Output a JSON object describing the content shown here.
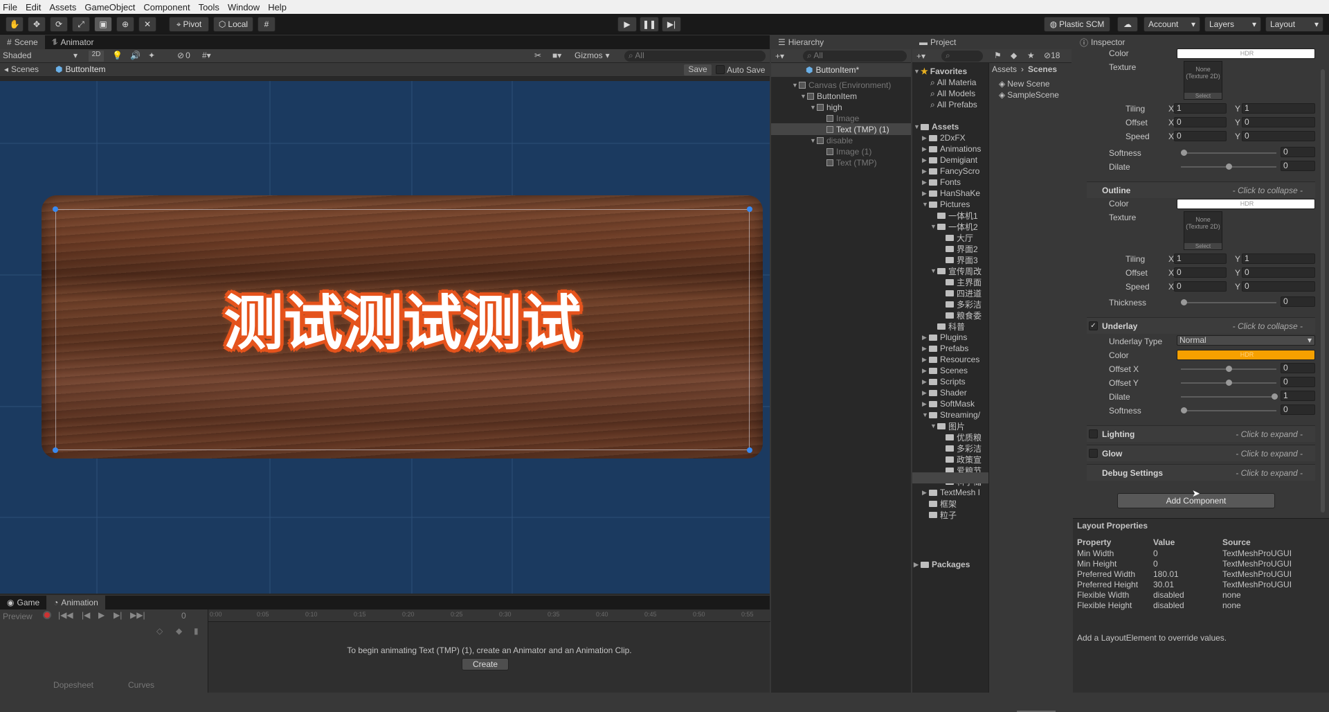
{
  "menu": [
    "File",
    "Edit",
    "Assets",
    "GameObject",
    "Component",
    "Tools",
    "Window",
    "Help"
  ],
  "toolbar": {
    "pivot": "Pivot",
    "local": "Local",
    "plastic": "Plastic SCM",
    "account": "Account",
    "layers": "Layers",
    "layout": "Layout"
  },
  "scene": {
    "tabs": [
      "Scene",
      "Animator"
    ],
    "shading": "Shaded",
    "mode2d": "2D",
    "gizmos": "Gizmos",
    "search_placeholder": "All",
    "count": "0",
    "bc_root": "Scenes",
    "bc_item": "ButtonItem",
    "save": "Save",
    "autosave": "Auto Save",
    "button_text": "测试测试测试"
  },
  "hierarchy": {
    "tab": "Hierarchy",
    "search_placeholder": "All",
    "root": "ButtonItem*",
    "items": [
      "Canvas (Environment)",
      "ButtonItem",
      "high",
      "Image",
      "Text (TMP) (1)",
      "disable",
      "Image (1)",
      "Text (TMP)"
    ]
  },
  "project": {
    "tab": "Project",
    "count": "18",
    "favorites": "Favorites",
    "fav_items": [
      "All Materia",
      "All Models",
      "All Prefabs"
    ],
    "assets": "Assets",
    "folders": [
      "2DxFX",
      "Animations",
      "Demigiant",
      "FancyScro",
      "Fonts",
      "HanShaKe",
      "Pictures",
      "一体机1",
      "一体机2",
      "大厅",
      "界面2",
      "界面3",
      "宣传周改",
      "主界面",
      "四进道",
      "多彩洁",
      "粮食委",
      "科普",
      "Plugins",
      "Prefabs",
      "Resources",
      "Scenes",
      "Scripts",
      "Shader",
      "SoftMask",
      "Streaming/",
      "图片",
      "优质粮",
      "多彩洁",
      "政策宣",
      "爱粮节",
      "科学储",
      "TextMesh I",
      "框架",
      "粒子"
    ],
    "packages": "Packages",
    "breadcrumb": [
      "Assets",
      "Scenes"
    ],
    "files": [
      "New Scene",
      "SampleScene"
    ]
  },
  "inspector": {
    "tab": "Inspector",
    "face": {
      "color": "Color",
      "hdr": "HDR",
      "texture": "Texture",
      "tex_none": "None (Texture 2D)",
      "select": "Select",
      "tiling": "Tiling",
      "offset": "Offset",
      "speed": "Speed",
      "x": "X",
      "y": "Y",
      "tiling_x": "1",
      "tiling_y": "1",
      "offset_x": "0",
      "offset_y": "0",
      "speed_x": "0",
      "speed_y": "0",
      "softness": "Softness",
      "softness_val": "0",
      "dilate": "Dilate",
      "dilate_val": "0"
    },
    "outline": {
      "title": "Outline",
      "collapse": "- Click to collapse -",
      "color": "Color",
      "hdr": "HDR",
      "texture": "Texture",
      "tex_none": "None (Texture 2D)",
      "select": "Select",
      "tiling": "Tiling",
      "offset": "Offset",
      "speed": "Speed",
      "x": "X",
      "y": "Y",
      "tiling_x": "1",
      "tiling_y": "1",
      "offset_x": "0",
      "offset_y": "0",
      "speed_x": "0",
      "speed_y": "0",
      "thickness": "Thickness",
      "thickness_val": "0"
    },
    "underlay": {
      "title": "Underlay",
      "collapse": "- Click to collapse -",
      "type_label": "Underlay Type",
      "type_val": "Normal",
      "color": "Color",
      "hdr": "HDR",
      "offset_x": "Offset X",
      "offset_x_val": "0",
      "offset_y": "Offset Y",
      "offset_y_val": "0",
      "dilate": "Dilate",
      "dilate_val": "1",
      "softness": "Softness",
      "softness_val": "0"
    },
    "lighting": "Lighting",
    "glow": "Glow",
    "debug": "Debug Settings",
    "expand": "- Click to expand -",
    "add_component": "Add Component",
    "layout": {
      "title": "Layout Properties",
      "headers": [
        "Property",
        "Value",
        "Source"
      ],
      "rows": [
        [
          "Min Width",
          "0",
          "TextMeshProUGUI"
        ],
        [
          "Min Height",
          "0",
          "TextMeshProUGUI"
        ],
        [
          "Preferred Width",
          "180.01",
          "TextMeshProUGUI"
        ],
        [
          "Preferred Height",
          "30.01",
          "TextMeshProUGUI"
        ],
        [
          "Flexible Width",
          "disabled",
          "none"
        ],
        [
          "Flexible Height",
          "disabled",
          "none"
        ]
      ],
      "hint": "Add a LayoutElement to override values."
    }
  },
  "animation": {
    "tabs": [
      "Game",
      "Animation"
    ],
    "preview": "Preview",
    "frame": "0",
    "ticks": [
      "0:00",
      "0:05",
      "0:10",
      "0:15",
      "0:20",
      "0:25",
      "0:30",
      "0:35",
      "0:40",
      "0:45",
      "0:50",
      "0:55"
    ],
    "message": "To begin animating Text (TMP) (1), create an Animator and an Animation Clip.",
    "create": "Create",
    "dopesheet": "Dopesheet",
    "curves": "Curves"
  },
  "colors": {
    "underlay": "#f6a000",
    "wood": "#6a3a24",
    "text_outline": "#e5531c",
    "scene_bg": "#1b3a60"
  }
}
